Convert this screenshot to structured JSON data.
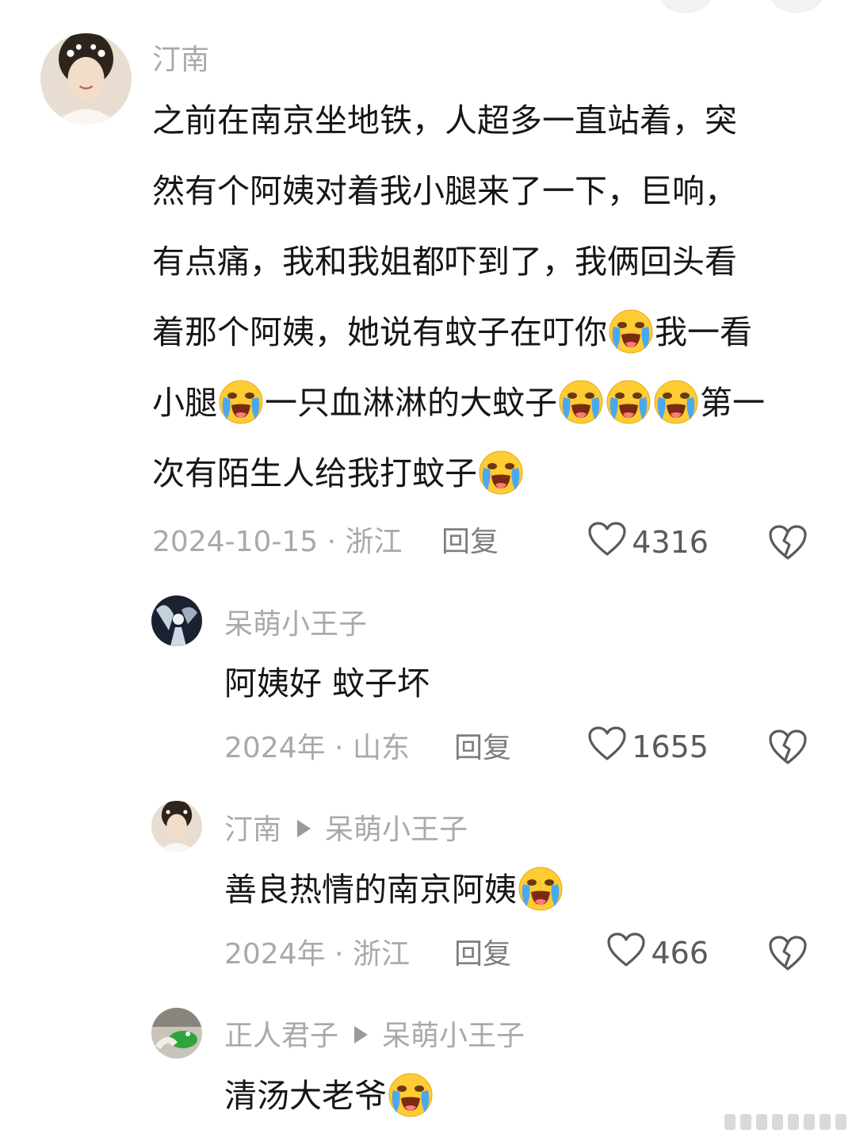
{
  "comments": [
    {
      "author": "汀南",
      "lines": [
        "之前在南京坐地铁，人超多一直站着，突",
        "然有个阿姨对着我小腿来了一下，巨响，",
        "有点痛，我和我姐都吓到了，我俩回头看",
        "着那个阿姨，她说有蚊子在叮你[cry]我一看",
        "小腿[cry]一只血淋淋的大蚊子[cry][cry][cry]第一",
        "次有陌生人给我打蚊子[cry]"
      ],
      "date_location": "2024-10-15 · 浙江",
      "reply_label": "回复",
      "likes": "4316"
    },
    {
      "author": "呆萌小王子",
      "lines": [
        "阿姨好 蚊子坏"
      ],
      "date_location": "2024年 · 山东",
      "reply_label": "回复",
      "likes": "1655"
    },
    {
      "author": "汀南",
      "reply_to": "呆萌小王子",
      "lines": [
        "善良热情的南京阿姨[cry]"
      ],
      "date_location": "2024年 · 浙江",
      "reply_label": "回复",
      "likes": "466"
    },
    {
      "author": "正人君子",
      "reply_to": "呆萌小王子",
      "lines": [
        "清汤大老爷[cry]"
      ]
    }
  ],
  "icons": {
    "like": "heart-outline-icon",
    "dislike": "broken-heart-icon",
    "emoji": "loudly-crying-face-emoji"
  },
  "colors": {
    "background": "#ffffff",
    "text": "#161616",
    "meta": "#a9a9a9"
  }
}
